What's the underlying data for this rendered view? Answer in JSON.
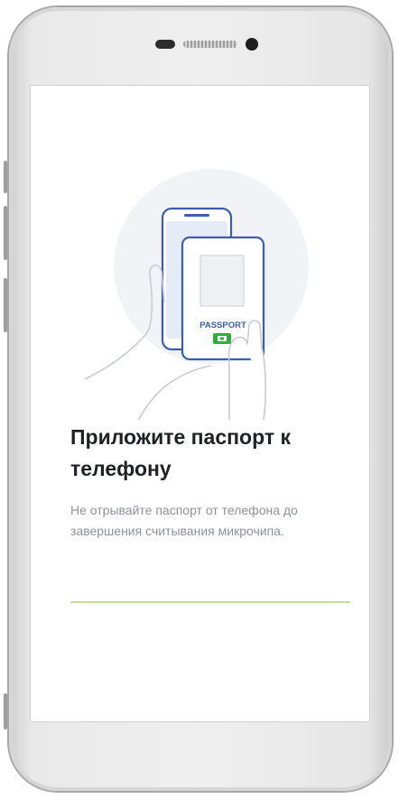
{
  "screen": {
    "title": "Приложите паспорт к телефону",
    "description": "Не отрывайте паспорт от телефона до завершения считывания микрочипа.",
    "passport_label": "PASSPORT",
    "progress": 1.0
  },
  "icons": {
    "illustration": "passport-on-phone-illustration",
    "chip": "nfc-chip-icon"
  },
  "colors": {
    "accent_blue": "#3d5db0",
    "chip_green": "#2fae3a",
    "progress": "#c3dca0",
    "title": "#1f2126",
    "description": "#8e9299"
  }
}
